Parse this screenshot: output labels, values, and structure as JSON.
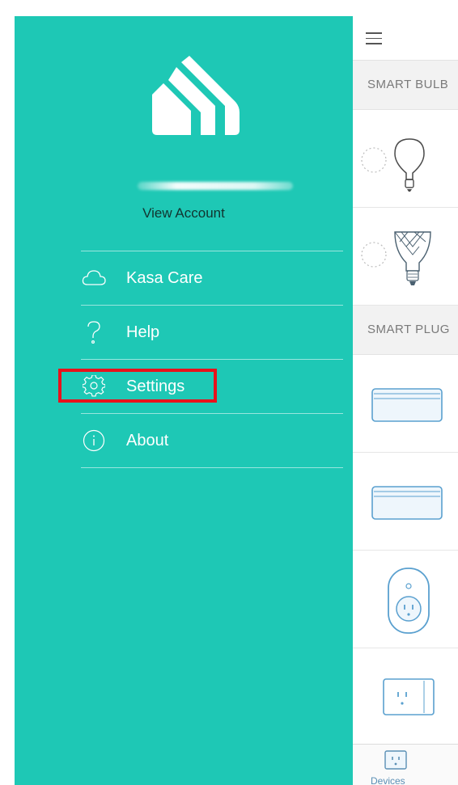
{
  "drawer": {
    "account_link": "View Account",
    "menu": [
      {
        "label": "Kasa Care",
        "icon": "cloud-icon"
      },
      {
        "label": "Help",
        "icon": "question-icon"
      },
      {
        "label": "Settings",
        "icon": "gear-icon"
      },
      {
        "label": "About",
        "icon": "info-icon"
      }
    ],
    "highlighted_item": "Settings",
    "highlight_color": "#e8121c",
    "background_color": "#1ec8b5"
  },
  "panel": {
    "sections": [
      {
        "label": "SMART BULB"
      },
      {
        "label": "SMART PLUG"
      }
    ],
    "tab": {
      "label": "Devices"
    }
  }
}
